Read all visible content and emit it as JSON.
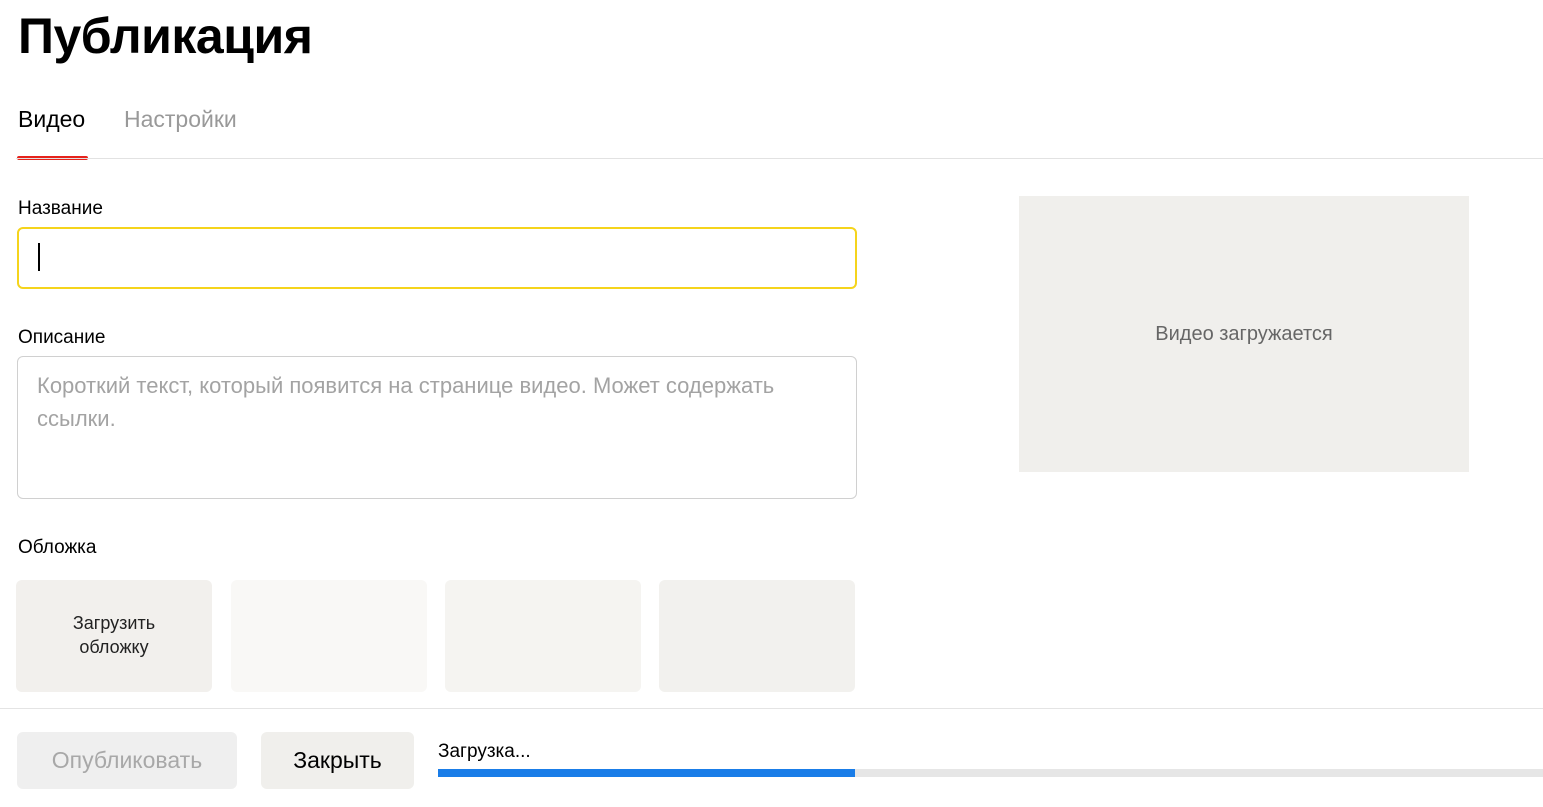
{
  "page": {
    "title": "Публикация"
  },
  "tabs": [
    {
      "label": "Видео",
      "active": true
    },
    {
      "label": "Настройки",
      "active": false
    }
  ],
  "form": {
    "title_label": "Название",
    "title_value": "",
    "description_label": "Описание",
    "description_placeholder": "Короткий текст, который появится на странице видео. Может содержать ссылки.",
    "cover_label": "Обложка",
    "cover_upload_label": "Загрузить обложку"
  },
  "preview": {
    "status_text": "Видео загружается"
  },
  "footer": {
    "publish_label": "Опубликовать",
    "close_label": "Закрыть",
    "upload_status": "Загрузка...",
    "upload_progress": 0.377
  },
  "colors": {
    "accent_tab": "#e5231c",
    "focus_border": "#f5d41c",
    "progress": "#1a7de8"
  },
  "icons": []
}
